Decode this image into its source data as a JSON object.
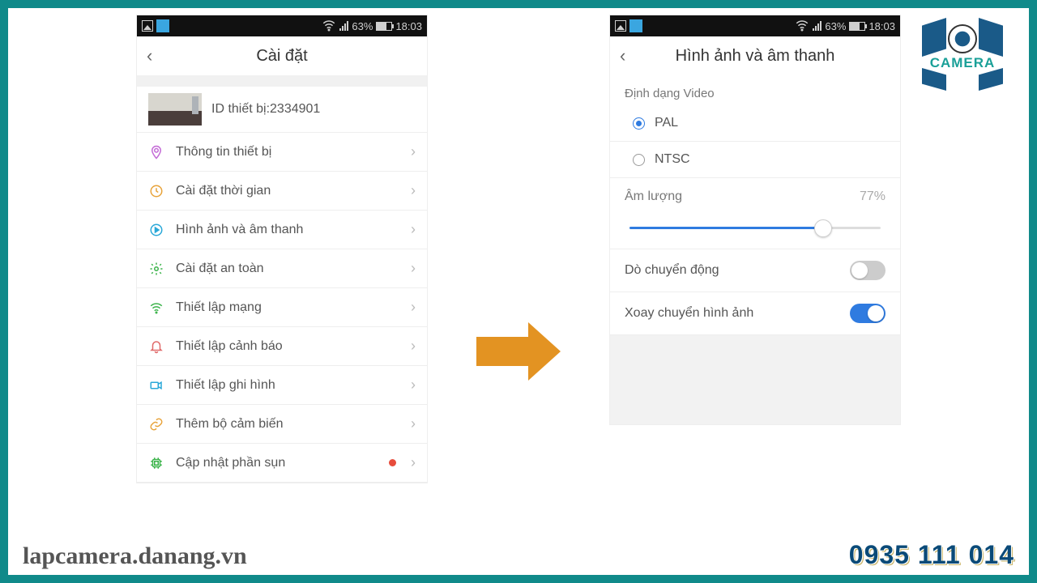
{
  "statusbar": {
    "battery_text": "63%",
    "time": "18:03"
  },
  "left": {
    "title": "Cài đặt",
    "device_id_label": "ID thiết bị:2334901",
    "menu": [
      {
        "label": "Thông tin thiết bị",
        "icon": "pin",
        "color": "#c36ad6"
      },
      {
        "label": "Cài đặt thời gian",
        "icon": "clock",
        "color": "#e8a33a"
      },
      {
        "label": "Hình ảnh và âm thanh",
        "icon": "play",
        "color": "#2aa8d8"
      },
      {
        "label": "Cài đặt an toàn",
        "icon": "gear",
        "color": "#3bb34a"
      },
      {
        "label": "Thiết lập mạng",
        "icon": "wifi",
        "color": "#3bb34a"
      },
      {
        "label": "Thiết lập cảnh báo",
        "icon": "bell",
        "color": "#e06a6a"
      },
      {
        "label": "Thiết lập ghi hình",
        "icon": "cam",
        "color": "#2aa8d8"
      },
      {
        "label": "Thêm bộ cảm biến",
        "icon": "link",
        "color": "#e8a33a"
      },
      {
        "label": "Cập nhật phần sụn",
        "icon": "chip",
        "color": "#3bb34a",
        "badge": true
      }
    ]
  },
  "right": {
    "title": "Hình ảnh và âm thanh",
    "video_format_label": "Định dạng Video",
    "pal_label": "PAL",
    "ntsc_label": "NTSC",
    "volume_label": "Âm lượng",
    "volume_value": "77%",
    "motion_label": "Dò chuyển động",
    "rotate_label": "Xoay chuyển hình ảnh"
  },
  "footer": {
    "url": "lapcamera.danang.vn",
    "phone": "0935 111 014"
  },
  "logo_text": "CAMERA"
}
